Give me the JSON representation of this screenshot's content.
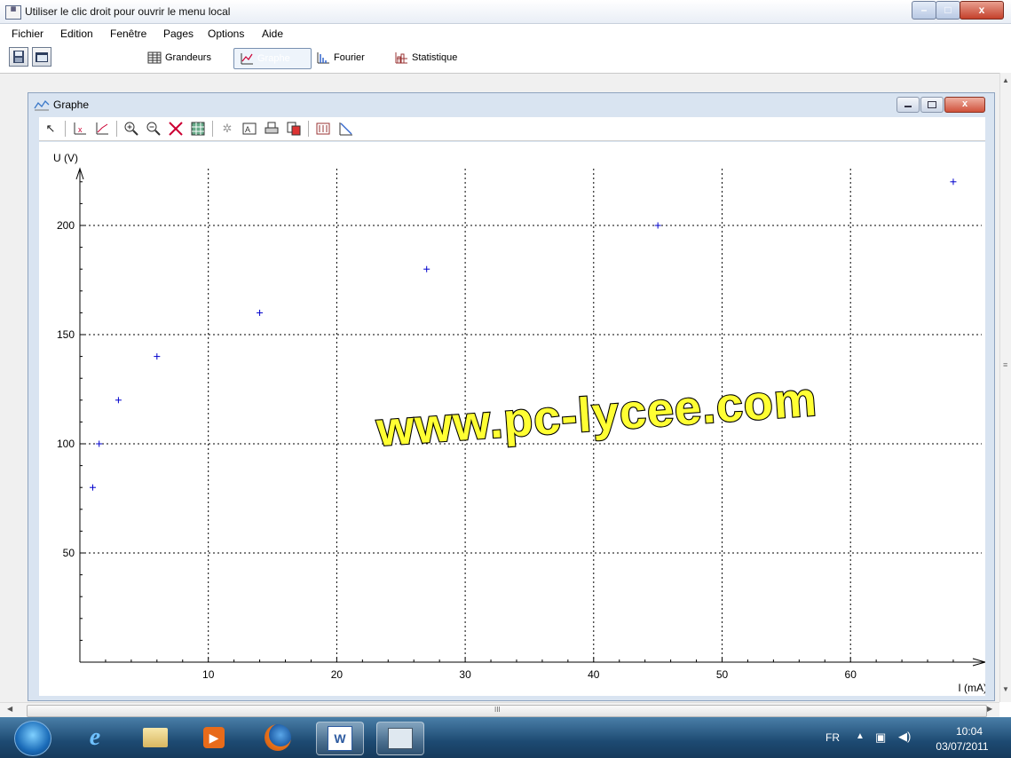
{
  "window": {
    "title": "Utiliser le clic droit pour ouvrir le menu local",
    "app_icon_text": "PC\nLY",
    "min_glyph": "–",
    "max_glyph": "□",
    "close_glyph": "x"
  },
  "menu": [
    "Fichier",
    "Edition",
    "Fenêtre",
    "Pages",
    "Options",
    "Aide"
  ],
  "toolbar": {
    "tabs": [
      {
        "label": "Grandeurs",
        "icon": "table-icon"
      },
      {
        "label": "Graphe",
        "icon": "graph-icon",
        "active": true
      },
      {
        "label": "Fourier",
        "icon": "spectrum-icon"
      },
      {
        "label": "Statistique",
        "icon": "statistics-icon"
      }
    ]
  },
  "graph_window": {
    "title": "Graphe",
    "tools": [
      "pointer-icon",
      "axis-x-icon",
      "axis-xy-icon",
      "zoom-in-icon",
      "zoom-out-icon",
      "cross-icon",
      "grid-icon",
      "model-icon",
      "text-icon",
      "print-icon",
      "copy-icon",
      "page-icon",
      "tangent-icon"
    ]
  },
  "chart_data": {
    "type": "scatter",
    "xlabel": "I (mA)",
    "ylabel": "U (V)",
    "xlim": [
      0,
      70
    ],
    "ylim": [
      0,
      225
    ],
    "xticks": [
      10,
      20,
      30,
      40,
      50,
      60
    ],
    "yticks": [
      50,
      100,
      150,
      200
    ],
    "grid": true,
    "marker_color": "#0000cc",
    "points": [
      {
        "x": 1,
        "y": 80
      },
      {
        "x": 1.5,
        "y": 100
      },
      {
        "x": 3,
        "y": 120
      },
      {
        "x": 6,
        "y": 140
      },
      {
        "x": 14,
        "y": 160
      },
      {
        "x": 27,
        "y": 180
      },
      {
        "x": 45,
        "y": 200
      },
      {
        "x": 68,
        "y": 220
      }
    ]
  },
  "watermark": "www.pc-lycee.com",
  "scrollbar": {
    "thumb_grip": "III"
  },
  "taskbar": {
    "apps": [
      "windows-start-icon",
      "internet-explorer-icon",
      "explorer-folder-icon",
      "media-player-icon",
      "firefox-icon",
      "word-icon",
      "app-window-icon"
    ],
    "lang": "FR",
    "time": "10:04",
    "date": "03/07/2011"
  }
}
